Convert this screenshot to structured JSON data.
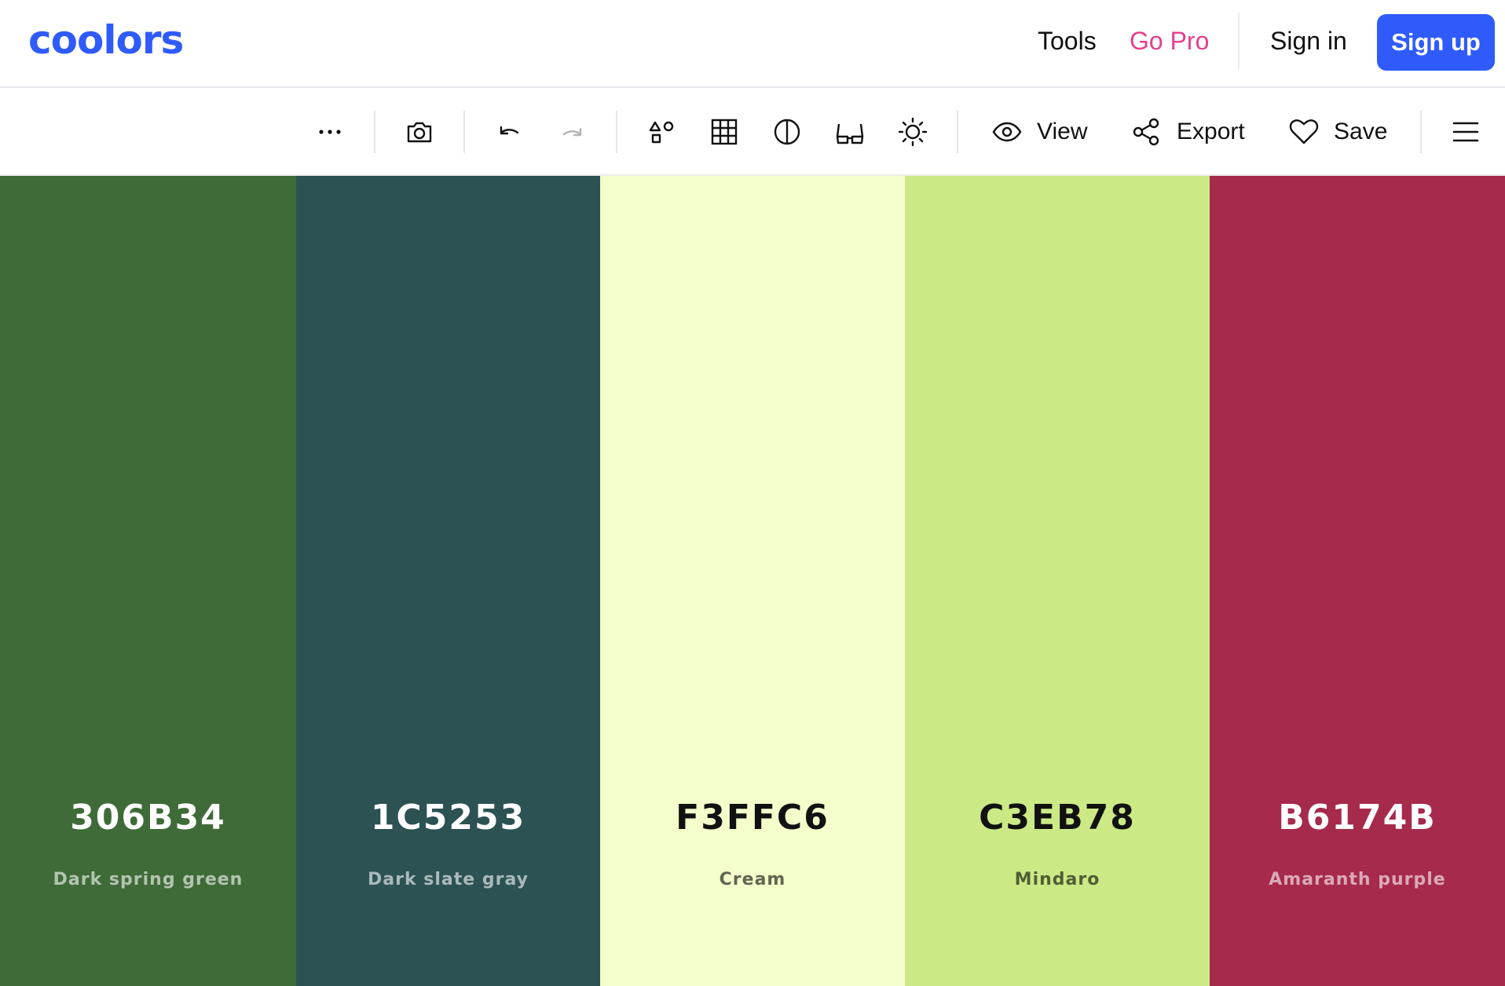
{
  "brand": {
    "logo_text": "coolors",
    "color": "#2f5bfb"
  },
  "nav": {
    "tools": "Tools",
    "go_pro": "Go Pro",
    "go_pro_color": "#e83e8c",
    "sign_in": "Sign in",
    "sign_up": "Sign up",
    "sign_up_color": "#2f5bfb"
  },
  "toolbar": {
    "icons": [
      "more-options-icon",
      "camera-icon",
      "undo-icon",
      "redo-icon",
      "shapes-icon",
      "grid-icon",
      "contrast-icon",
      "glasses-icon",
      "brightness-icon"
    ],
    "view_label": "View",
    "export_label": "Export",
    "save_label": "Save"
  },
  "palette": [
    {
      "hex": "306B34",
      "name": "Dark spring green",
      "bg": "#3f6b38",
      "text": "#ffffff",
      "subtext": "rgba(255,255,255,0.6)"
    },
    {
      "hex": "1C5253",
      "name": "Dark slate gray",
      "bg": "#2c5253",
      "text": "#ffffff",
      "subtext": "rgba(255,255,255,0.6)"
    },
    {
      "hex": "F3FFC6",
      "name": "Cream",
      "bg": "#f3fecb",
      "text": "#111111",
      "subtext": "rgba(0,0,0,0.6)"
    },
    {
      "hex": "C3EB78",
      "name": "Mindaro",
      "bg": "#cbea86",
      "text": "#111111",
      "subtext": "rgba(0,0,0,0.6)"
    },
    {
      "hex": "B6174B",
      "name": "Amaranth purple",
      "bg": "#a62a4b",
      "text": "#ffffff",
      "subtext": "rgba(255,255,255,0.6)"
    }
  ]
}
